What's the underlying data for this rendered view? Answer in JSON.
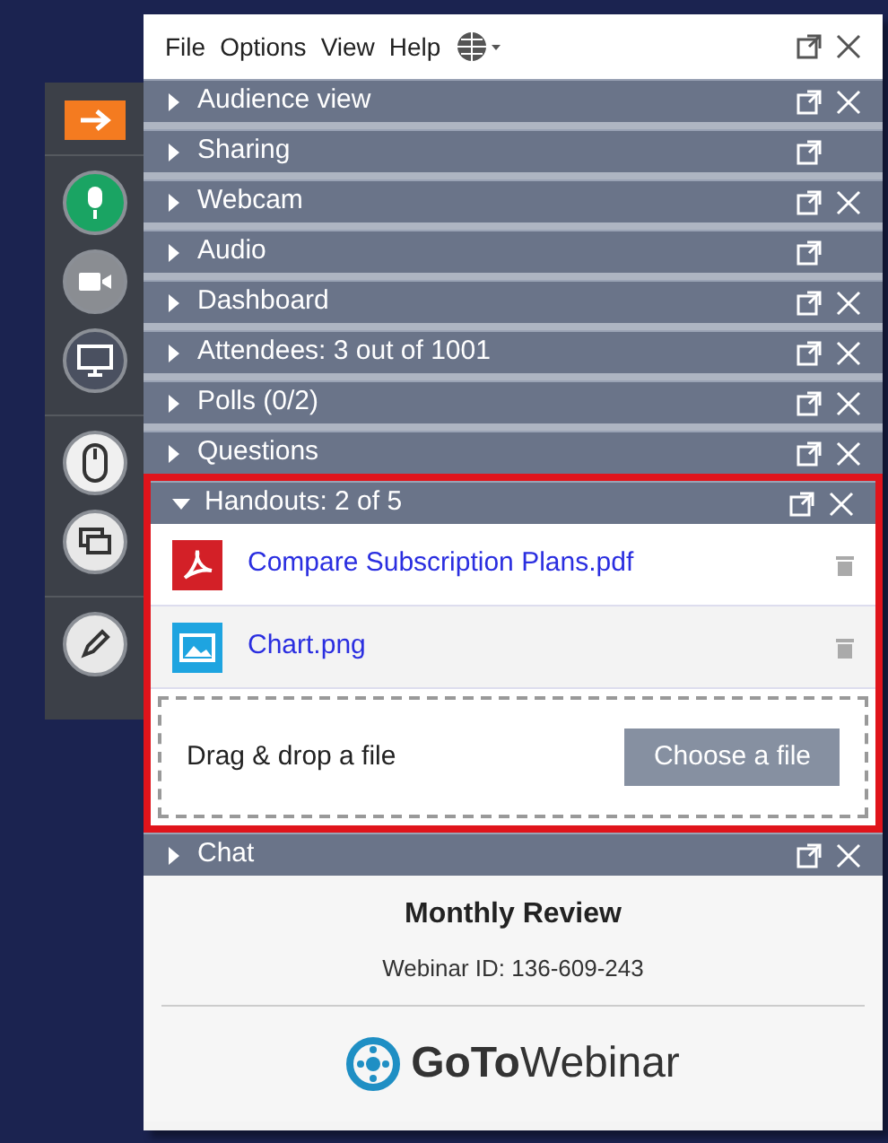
{
  "menu": [
    "File",
    "Options",
    "View",
    "Help"
  ],
  "sections": [
    {
      "title": "Audience view",
      "expanded": false,
      "closable": true
    },
    {
      "title": "Sharing",
      "expanded": false,
      "closable": false
    },
    {
      "title": "Webcam",
      "expanded": false,
      "closable": true
    },
    {
      "title": "Audio",
      "expanded": false,
      "closable": false
    },
    {
      "title": "Dashboard",
      "expanded": false,
      "closable": true
    },
    {
      "title": "Attendees:  3 out of 1001",
      "expanded": false,
      "closable": true
    },
    {
      "title": "Polls (0/2)",
      "expanded": false,
      "closable": true
    },
    {
      "title": "Questions",
      "expanded": false,
      "closable": true
    }
  ],
  "handouts": {
    "title": "Handouts: 2 of 5",
    "expanded": true,
    "closable": true,
    "files": [
      {
        "name": "Compare Subscription Plans.pdf",
        "kind": "pdf"
      },
      {
        "name": "Chart.png",
        "kind": "image"
      }
    ],
    "drop_label": "Drag & drop a file",
    "choose_button": "Choose a file"
  },
  "chat": {
    "title": "Chat",
    "expanded": false,
    "closable": true
  },
  "footer": {
    "title": "Monthly Review",
    "webinar_id": "Webinar ID: 136-609-243",
    "brand_bold": "GoTo",
    "brand_rest": "Webinar"
  }
}
